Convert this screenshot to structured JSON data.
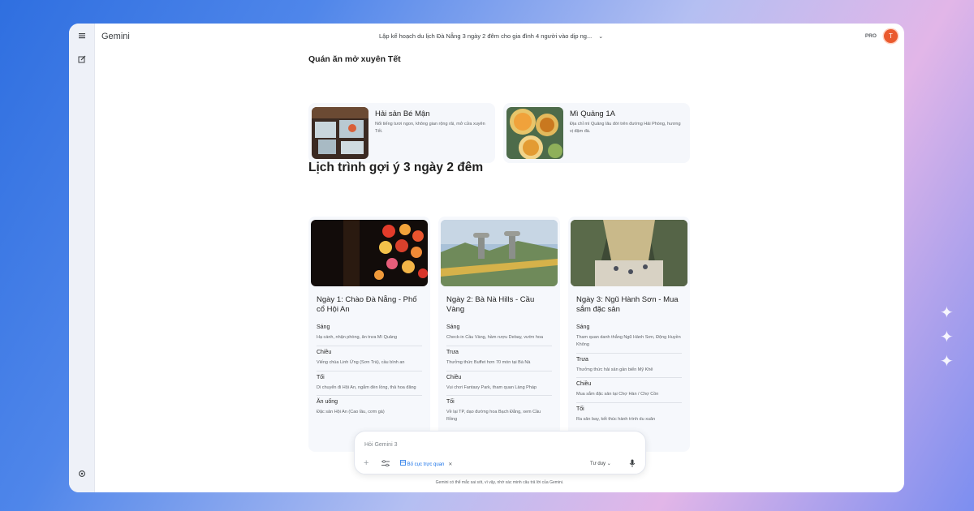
{
  "app": {
    "name": "Gemini",
    "plan_badge": "PRO",
    "avatar_initial": "T"
  },
  "conversation": {
    "title": "Lập kế hoạch du lịch Đà Nẵng 3 ngày 2 đêm cho gia đình 4 người vào dịp ng..."
  },
  "icons": {
    "menu": "menu-icon",
    "new_chat": "edit-icon",
    "settings": "gear-icon",
    "dropdown": "chevron-down-icon"
  },
  "restaurants": {
    "heading": "Quán ăn mở xuyên Tết",
    "items": [
      {
        "name": "Hải sản Bé Mận",
        "description": "Nổi tiếng tươi ngon, không gian rộng rãi, mở cửa xuyên Tết."
      },
      {
        "name": "Mì Quảng 1A",
        "description": "Địa chỉ mì Quảng lâu đời trên đường Hải Phòng, hương vị đậm đà."
      }
    ]
  },
  "itinerary": {
    "heading": "Lịch trình gợi ý 3 ngày 2 đêm",
    "days": [
      {
        "title": "Ngày 1: Chào Đà Nẵng - Phố cổ Hội An",
        "sections": [
          {
            "label": "Sáng",
            "text": "Hạ cánh, nhận phòng, ăn trưa Mì Quảng"
          },
          {
            "label": "Chiều",
            "text": "Viếng chùa Linh Ứng (Sơn Trà), cầu bình an"
          },
          {
            "label": "Tối",
            "text": "Di chuyển đi Hội An, ngắm đèn lồng, thả hoa đăng"
          },
          {
            "label": "Ăn uống",
            "text": "Đặc sản Hội An (Cao lầu, cơm gà)"
          }
        ]
      },
      {
        "title": "Ngày 2: Bà Nà Hills - Cầu Vàng",
        "sections": [
          {
            "label": "Sáng",
            "text": "Check-in Cầu Vàng, hầm rượu Debay, vườn hoa"
          },
          {
            "label": "Trưa",
            "text": "Thưởng thức Buffet hơn 70 món tại Bà Nà"
          },
          {
            "label": "Chiều",
            "text": "Vui chơi Fantasy Park, tham quan Làng Pháp"
          },
          {
            "label": "Tối",
            "text": "Về lại TP, dạo đường hoa Bạch Đằng, xem Cầu Rồng"
          }
        ]
      },
      {
        "title": "Ngày 3: Ngũ Hành Sơn - Mua sắm đặc sản",
        "sections": [
          {
            "label": "Sáng",
            "text": "Tham quan danh thắng Ngũ Hành Sơn, Động Huyền Không"
          },
          {
            "label": "Trưa",
            "text": "Thưởng thức hải sản gần biển Mỹ Khê"
          },
          {
            "label": "Chiều",
            "text": "Mua sắm đặc sản tại Chợ Hàn / Chợ Cồn"
          },
          {
            "label": "Tối",
            "text": "Ra sân bay, kết thúc hành trình du xuân"
          }
        ]
      }
    ]
  },
  "composer": {
    "placeholder": "Hỏi Gemini 3",
    "chip_label": "Bố cục trực quan",
    "mode_label": "Tư duy"
  },
  "footer": {
    "disclaimer": "Gemini có thể mắc sai sót, vì vậy, nhớ xác minh câu trả lời của Gemini."
  },
  "colors": {
    "accent": "#1a73e8",
    "avatar": "#ea5a2e",
    "rail": "#eef1f8",
    "card": "#f5f7fb"
  }
}
